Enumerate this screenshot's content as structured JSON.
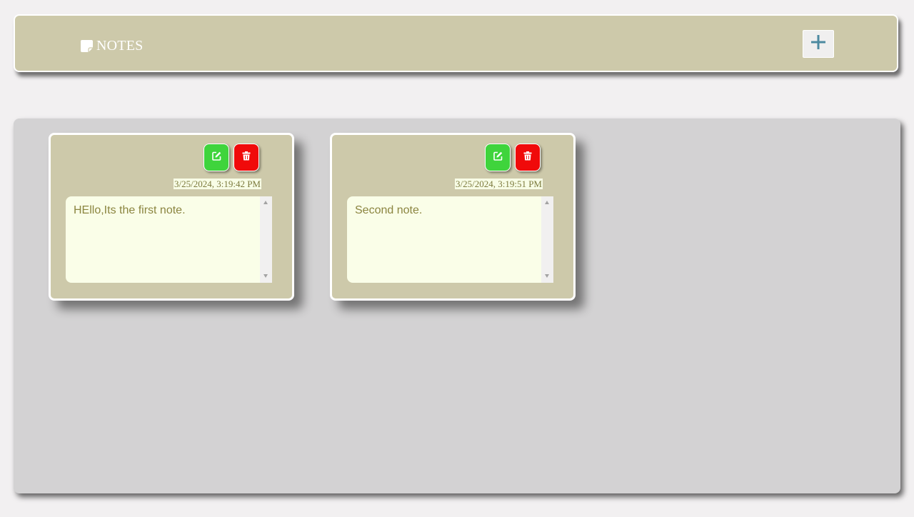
{
  "header": {
    "title": "NOTES",
    "brand_icon": "sticky-note-icon",
    "add_icon": "plus-icon"
  },
  "colors": {
    "accent": "#cdc9aa",
    "edit": "#3fd43c",
    "delete": "#f00a0a",
    "note_text": "#8b8540",
    "textarea_bg": "#fafee8",
    "board_bg": "#d3d2d3"
  },
  "notes": [
    {
      "timestamp": "3/25/2024, 3:19:42 PM",
      "content": "HEllo,Its the first note.",
      "edit_icon": "edit-icon",
      "delete_icon": "trash-icon"
    },
    {
      "timestamp": "3/25/2024, 3:19:51 PM",
      "content": "Second note.",
      "edit_icon": "edit-icon",
      "delete_icon": "trash-icon"
    }
  ]
}
